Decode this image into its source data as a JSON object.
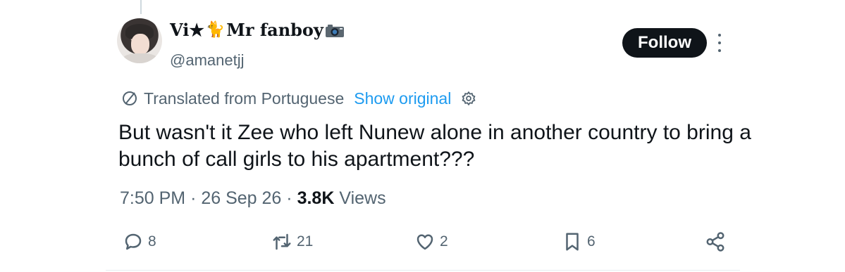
{
  "author": {
    "name_prefix": "Vi★",
    "name_emoji": "🐈",
    "name_main": "Mr fanboy",
    "handle": "@amanetjj"
  },
  "follow_label": "Follow",
  "translation": {
    "note": "Translated from Portuguese",
    "show_original": "Show original"
  },
  "tweet": {
    "text": "But wasn't it Zee who left Nunew alone in another country to bring a bunch of call girls to his apartment???",
    "time": "7:50 PM",
    "date": "26 Sep 26",
    "views_count": "3.8K",
    "views_label": "Views"
  },
  "actions": {
    "replies": "8",
    "reposts": "21",
    "likes": "2",
    "bookmarks": "6"
  },
  "icons": [
    "avatar",
    "camera-icon",
    "more-icon",
    "globe-translate-icon",
    "gear-icon",
    "reply-icon",
    "repost-icon",
    "like-icon",
    "bookmark-icon",
    "share-icon"
  ],
  "colors": {
    "link": "#1d9bf0",
    "muted": "#536471",
    "text": "#0f1419",
    "follow_bg": "#0f1419"
  }
}
